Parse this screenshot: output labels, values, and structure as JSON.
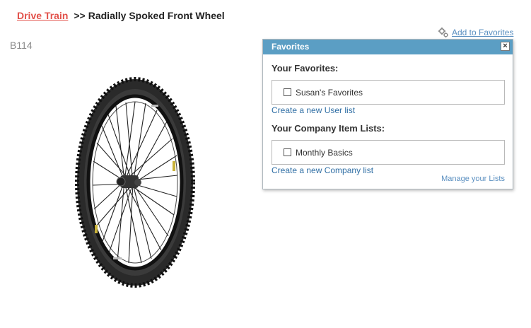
{
  "breadcrumb": {
    "parent": "Drive Train",
    "separator": ">>",
    "current": "Radially Spoked Front Wheel"
  },
  "product": {
    "sku": "B114"
  },
  "toolbar": {
    "add_to_favorites": "Add to Favorites"
  },
  "favorites_popup": {
    "title": "Favorites",
    "close_label": "×",
    "your_favorites": {
      "heading": "Your Favorites:",
      "items": [
        {
          "label": "Susan's Favorites",
          "checked": false
        }
      ],
      "create_link": "Create a new User list"
    },
    "company_lists": {
      "heading": "Your Company Item Lists:",
      "items": [
        {
          "label": "Monthly Basics",
          "checked": false
        }
      ],
      "create_link": "Create a new Company list"
    },
    "manage_link": "Manage your Lists"
  },
  "colors": {
    "breadcrumb_link": "#e2514a",
    "header_bg": "#5b9ec4",
    "link": "#2f6ea4"
  },
  "icons": {
    "add_favorites": "gear-icon",
    "close": "close-icon"
  }
}
